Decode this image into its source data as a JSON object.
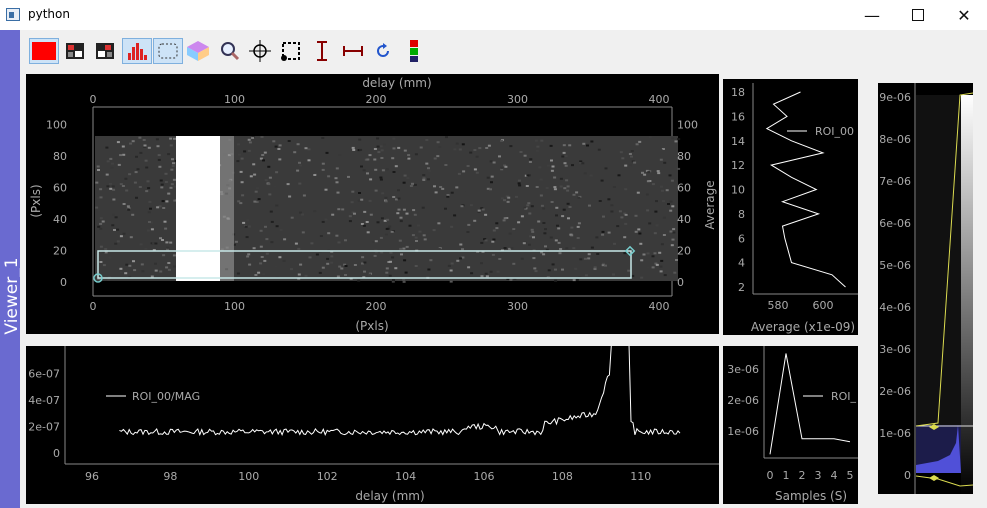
{
  "window": {
    "title": "python"
  },
  "dock": {
    "label": "Viewer_1"
  },
  "toolbar": {
    "buttons": [
      "red-square",
      "image-icon",
      "image-alt-icon",
      "histogram-icon",
      "roi-select-icon",
      "color-cube-icon",
      "zoom-icon",
      "crosshair-icon",
      "roi-crop-icon",
      "vertical-measure-icon",
      "horizontal-measure-icon",
      "refresh-icon",
      "traffic-light-icon"
    ],
    "colors": {
      "red": "#ff0000",
      "active_bg": "#cde3f7"
    }
  },
  "image_plot": {
    "top_axis_label": "delay (mm)",
    "top_ticks": [
      "0",
      "100",
      "200",
      "300",
      "400"
    ],
    "bottom_axis_label": "(Pxls)",
    "bottom_ticks": [
      "0",
      "100",
      "200",
      "300",
      "400"
    ],
    "left_axis_label": "(Pxls)",
    "left_ticks": [
      "0",
      "20",
      "40",
      "60",
      "80",
      "100"
    ],
    "right_axis_label": "Average",
    "right_ticks": [
      "0",
      "20",
      "40",
      "60",
      "80",
      "100"
    ]
  },
  "average_plot": {
    "legend": "ROI_00",
    "y_ticks": [
      "2",
      "4",
      "6",
      "8",
      "10",
      "12",
      "14",
      "16",
      "18"
    ],
    "x_ticks": [
      "580",
      "600"
    ],
    "x_label": "Average (x1e-09)"
  },
  "lineout_plot": {
    "legend": "ROI_00/MAG",
    "y_ticks": [
      "0",
      "2e-07",
      "4e-07",
      "6e-07"
    ],
    "x_ticks": [
      "96",
      "98",
      "100",
      "102",
      "104",
      "106",
      "108",
      "110"
    ],
    "x_label": "delay (mm)"
  },
  "samples_plot": {
    "legend": "ROI_",
    "y_ticks": [
      "1e-06",
      "2e-06",
      "3e-06"
    ],
    "x_ticks": [
      "0",
      "1",
      "2",
      "3",
      "4",
      "5"
    ],
    "x_label": "Samples (S)"
  },
  "histogram": {
    "ticks": [
      "0",
      "1e-06",
      "2e-06",
      "3e-06",
      "4e-06",
      "5e-06",
      "6e-06",
      "7e-06",
      "8e-06",
      "9e-06"
    ]
  }
}
